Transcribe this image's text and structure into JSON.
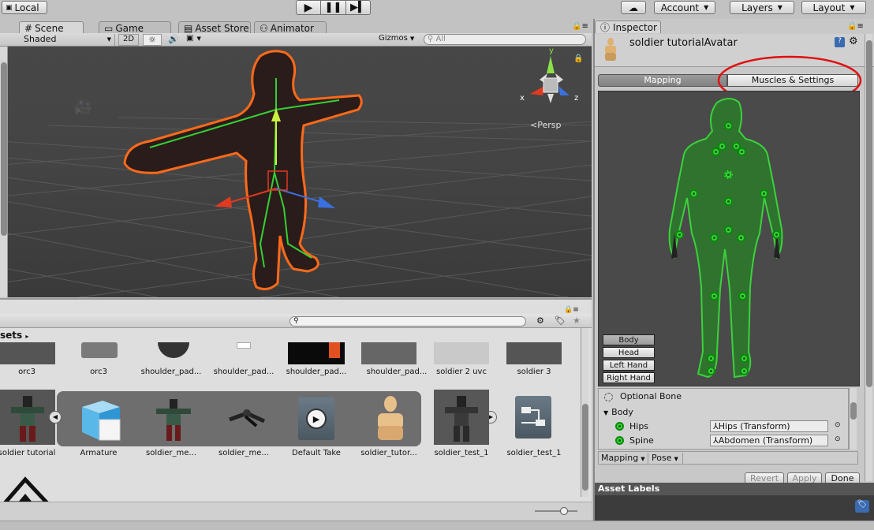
{
  "toolbar": {
    "local_label": "Local",
    "account_label": "Account",
    "layers_label": "Layers",
    "layout_label": "Layout"
  },
  "scene_tabs": {
    "scene": "Scene",
    "game": "Game",
    "asset_store": "Asset Store",
    "animator": "Animator"
  },
  "scene_toolbar": {
    "shading": "Shaded",
    "mode_2d": "2D",
    "gizmos": "Gizmos",
    "search_placeholder": "All"
  },
  "scene_view": {
    "axis_y": "y",
    "axis_x": "x",
    "axis_z": "z",
    "projection": "Persp"
  },
  "project": {
    "breadcrumb": "sets",
    "row1": [
      "orc3",
      "orc3",
      "shoulder_pad...",
      "shoulder_pad...",
      "shoulder_pad...",
      "soldier 2 uvc",
      "soldier 3"
    ],
    "row2": [
      "soldier tutorial",
      "Armature",
      "soldier_me...",
      "soldier_me...",
      "Default Take",
      "soldier_tutor...",
      "soldier_test_1",
      "soldier_test_1"
    ]
  },
  "inspector": {
    "tab": "Inspector",
    "title": "soldier tutorialAvatar",
    "mapping_tab": "Mapping",
    "muscles_tab": "Muscles & Settings",
    "body_buttons": [
      "Body",
      "Head",
      "Left Hand",
      "Right Hand"
    ],
    "optional_bone": "Optional Bone",
    "body_section": "Body",
    "bones": [
      {
        "name": "Hips",
        "transform": "Hips (Transform)"
      },
      {
        "name": "Spine",
        "transform": "Abdomen (Transform)"
      }
    ],
    "mapping_dropdown": "Mapping",
    "pose_dropdown": "Pose",
    "revert": "Revert",
    "apply": "Apply",
    "done": "Done",
    "asset_labels": "Asset Labels"
  },
  "colors": {
    "accent_green": "#3bd23b",
    "highlight_red": "#e01010",
    "selection_orange": "#ff6a1a"
  }
}
